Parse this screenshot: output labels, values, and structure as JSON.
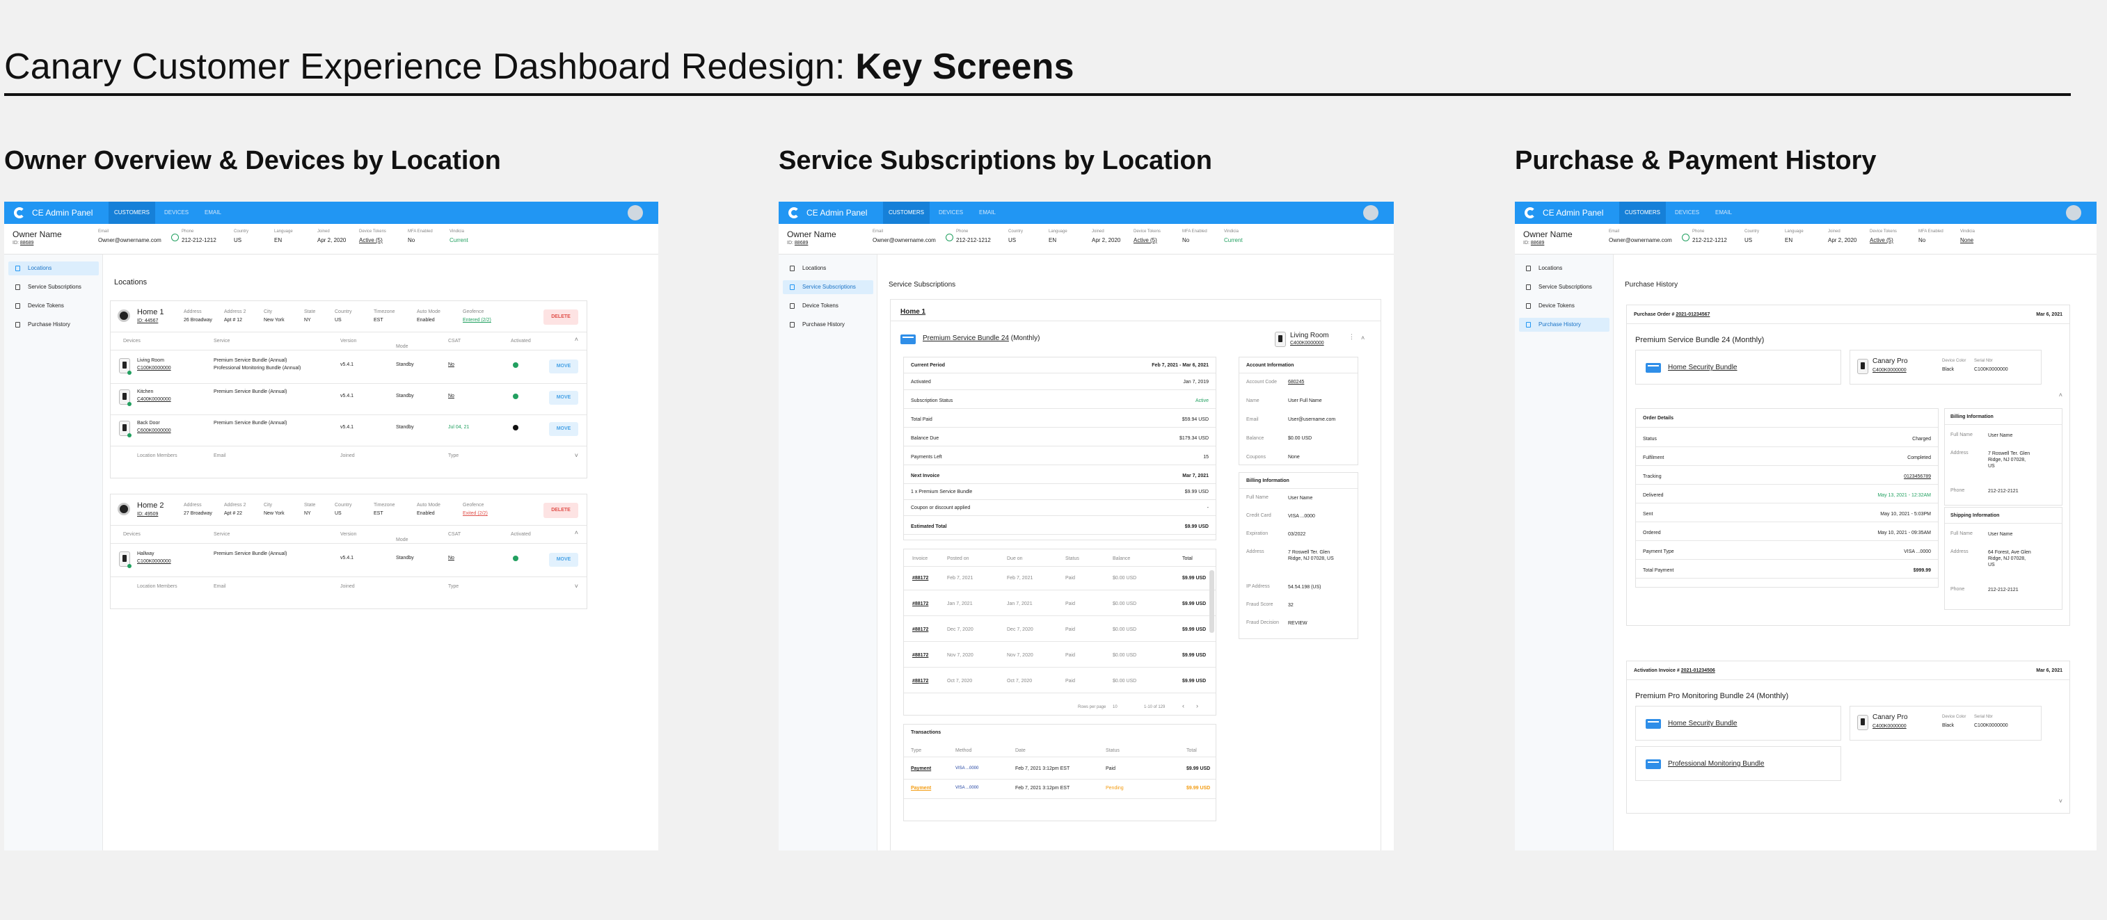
{
  "title": {
    "light": "Canary Customer Experience Dashboard Redesign: ",
    "bold": "Key Screens"
  },
  "sections": [
    "Owner Overview & Devices by Location",
    "Service Subscriptions by Location",
    "Purchase & Payment History"
  ],
  "app": {
    "brand": "CE Admin Panel",
    "tabs": [
      "CUSTOMERS",
      "DEVICES",
      "EMAIL"
    ]
  },
  "owner": {
    "name": "Owner Name",
    "id_label": "ID:",
    "id": "88689",
    "fields": [
      {
        "label": "Email",
        "value": "Owner@ownername.com"
      },
      {
        "label": "Phone",
        "value": "212-212-1212"
      },
      {
        "label": "Country",
        "value": "US"
      },
      {
        "label": "Language",
        "value": "EN"
      },
      {
        "label": "Joined",
        "value": "Apr 2, 2020"
      },
      {
        "label": "Device Tokens",
        "value": "Active (5)"
      },
      {
        "label": "MFA Enabled",
        "value": "No"
      },
      {
        "label": "Vindicia",
        "value": "Current"
      }
    ],
    "vindicia_alt": "None"
  },
  "sidebar": [
    "Locations",
    "Service Subscriptions",
    "Device Tokens",
    "Purchase History"
  ],
  "colors": {
    "accent": "#2196f3",
    "danger": "#e0504b",
    "success": "#22a060",
    "warning": "#f39c12"
  },
  "locations": {
    "heading": "Locations",
    "loc_headers": [
      "Address",
      "Address 2",
      "City",
      "State",
      "Country",
      "Timezone",
      "Auto Mode",
      "Geofence"
    ],
    "device_headers": [
      "Devices",
      "Service",
      "Version",
      "Mode",
      "CSAT",
      "Activated"
    ],
    "members_headers": [
      "Location Members",
      "Email",
      "Joined",
      "Type"
    ],
    "delete": "DELETE",
    "move": "MOVE",
    "homes": [
      {
        "name": "Home 1",
        "id": "ID: 44567",
        "values": [
          "26 Broadway",
          "Apt # 12",
          "New York",
          "NY",
          "US",
          "EST",
          "Enabled",
          "Entered (2/2)"
        ],
        "devices": [
          {
            "name": "Living Room",
            "serial": "C100K0000000",
            "services": [
              "Premium Service Bundle (Annual)",
              "Professional Monitoring Bundle (Annual)"
            ],
            "version": "v5.4.1",
            "mode": "Standby",
            "csat": "No",
            "activated": "green"
          },
          {
            "name": "Kitchen",
            "serial": "C400K0000000",
            "services": [
              "Premium Service Bundle (Annual)"
            ],
            "version": "v5.4.1",
            "mode": "Standby",
            "csat": "No",
            "activated": "green"
          },
          {
            "name": "Back Door",
            "serial": "C600K0000000",
            "services": [
              "Premium Service Bundle (Annual)"
            ],
            "version": "v5.4.1",
            "mode": "Standby",
            "csat": "Jul 04, 21",
            "activated": "black"
          }
        ]
      },
      {
        "name": "Home 2",
        "id": "ID: 49509",
        "values": [
          "27 Broadway",
          "Apt # 22",
          "New York",
          "NY",
          "US",
          "EST",
          "Enabled",
          "Exited (2/2)"
        ],
        "devices": [
          {
            "name": "Hallway",
            "serial": "C100K0000000",
            "services": [
              "Premium Service Bundle (Annual)"
            ],
            "version": "v5.4.1",
            "mode": "Standby",
            "csat": "No",
            "activated": "green"
          }
        ]
      }
    ]
  },
  "subs": {
    "heading": "Service Subscriptions",
    "home": "Home 1",
    "bundle": "Premium Service Bundle 24",
    "bundle_suffix": "(Monthly)",
    "device": "Living Room",
    "device_serial": "C400K0000000",
    "current_period": {
      "label": "Current Period",
      "value": "Feb 7, 2021 - Mar 6, 2021"
    },
    "rows": [
      [
        "Activated",
        "Jan 7, 2019"
      ],
      [
        "Subscription Status",
        "Active"
      ],
      [
        "Total Paid",
        "$59.94 USD"
      ],
      [
        "Balance Due",
        "$179.34 USD"
      ],
      [
        "Payments Left",
        "15"
      ]
    ],
    "next_invoice": {
      "label": "Next Invoice",
      "value": "Mar 7, 2021"
    },
    "invoice_rows": [
      [
        "1 x Premium Service Bundle",
        "$9.99 USD"
      ],
      [
        "Coupon or discount applied",
        "-"
      ]
    ],
    "estimated": {
      "label": "Estimated Total",
      "value": "$9.99 USD"
    },
    "account": {
      "title": "Account Information",
      "rows": [
        [
          "Account Code",
          "680245"
        ],
        [
          "Name",
          "User Full Name"
        ],
        [
          "Email",
          "User@username.com"
        ],
        [
          "Balance",
          "$0.00 USD"
        ],
        [
          "Coupons",
          "None"
        ]
      ]
    },
    "billing": {
      "title": "Billing Information",
      "rows": [
        [
          "Full Name",
          "User Name"
        ],
        [
          "Credit Card",
          "VISA ...0000"
        ],
        [
          "Expiration",
          "03/2022"
        ],
        [
          "Address",
          "7 Roswell Ter. Glen Ridge, NJ 07028, US"
        ],
        [
          "IP Address",
          "54.54.198 (US)"
        ],
        [
          "Fraud Score",
          "32"
        ],
        [
          "Fraud Decision",
          "REVIEW"
        ]
      ]
    },
    "invoice_headers": [
      "Invoice",
      "Posted on",
      "Due on",
      "Status",
      "Balance",
      "Total"
    ],
    "invoices": [
      [
        "#88172",
        "Feb 7, 2021",
        "Feb 7, 2021",
        "Paid",
        "$0.00 USD",
        "$9.99 USD"
      ],
      [
        "#88172",
        "Jan 7, 2021",
        "Jan 7, 2021",
        "Paid",
        "$0.00 USD",
        "$9.99 USD"
      ],
      [
        "#88172",
        "Dec 7, 2020",
        "Dec 7, 2020",
        "Paid",
        "$0.00 USD",
        "$9.99 USD"
      ],
      [
        "#88172",
        "Nov 7, 2020",
        "Nov 7, 2020",
        "Paid",
        "$0.00 USD",
        "$9.99 USD"
      ],
      [
        "#88172",
        "Oct 7, 2020",
        "Oct 7, 2020",
        "Paid",
        "$0.00 USD",
        "$9.99 USD"
      ]
    ],
    "pager": {
      "rows_label": "Rows per page",
      "rows": "10",
      "range": "1-10 of 129"
    },
    "transactions_title": "Transactions",
    "tx_headers": [
      "Type",
      "Method",
      "Date",
      "Status",
      "Total"
    ],
    "transactions": [
      [
        "Payment",
        "VISA ...0000",
        "Feb 7, 2021  3:12pm EST",
        "Paid",
        "$9.99 USD"
      ],
      [
        "Payment",
        "VISA ...0000",
        "Feb 7, 2021  3:12pm EST",
        "Pending",
        "$9.99 USD"
      ]
    ]
  },
  "purchase": {
    "heading": "Purchase History",
    "order1": {
      "label": "Purchase Order #",
      "num": "2021-01234567",
      "date": "Mar 6, 2021",
      "bundle": "Premium Service Bundle 24",
      "suffix": "(Monthly)",
      "item": "Home Security Bundle",
      "device": "Canary Pro",
      "serial": "C400K0000000",
      "device_color_label": "Device Color",
      "device_color": "Black",
      "serial_label": "Serial Nbr",
      "serial_nbr": "C100K0000000"
    },
    "order_details": {
      "title": "Order Details",
      "rows": [
        [
          "Status",
          "Charged"
        ],
        [
          "Fulfilment",
          "Completed"
        ],
        [
          "Tracking",
          "0123456789"
        ],
        [
          "Delivered",
          "May 13, 2021 - 12:32AM"
        ],
        [
          "Sent",
          "May 10, 2021 - 5:03PM"
        ],
        [
          "Ordered",
          "May 10, 2021 - 09:35AM"
        ],
        [
          "Payment Type",
          "VISA ...0000"
        ],
        [
          "Total Payment",
          "$999.99"
        ]
      ]
    },
    "billing": {
      "title": "Billing Information",
      "rows": [
        [
          "Full Name",
          "User Name"
        ],
        [
          "Address",
          "7 Roswell Ter. Glen Ridge, NJ 07028, US"
        ],
        [
          "Phone",
          "212-212-2121"
        ]
      ]
    },
    "shipping": {
      "title": "Shipping Information",
      "rows": [
        [
          "Full Name",
          "User Name"
        ],
        [
          "Address",
          "64 Forest, Ave Glen Ridge, NJ 07028, US"
        ],
        [
          "Phone",
          "212-212-2121"
        ]
      ]
    },
    "order2": {
      "label": "Activation Invoice #",
      "num": "2021-01234506",
      "date": "Mar 6, 2021",
      "bundle": "Premium Pro Monitoring Bundle 24",
      "suffix": "(Monthly)",
      "items": [
        "Home Security Bundle",
        "Professional Monitoring Bundle"
      ],
      "device": "Canary Pro",
      "serial": "C400K0000000",
      "device_color_label": "Device Color",
      "device_color": "Black",
      "serial_label": "Serial Nbr",
      "serial_nbr": "C100K0000000"
    }
  }
}
